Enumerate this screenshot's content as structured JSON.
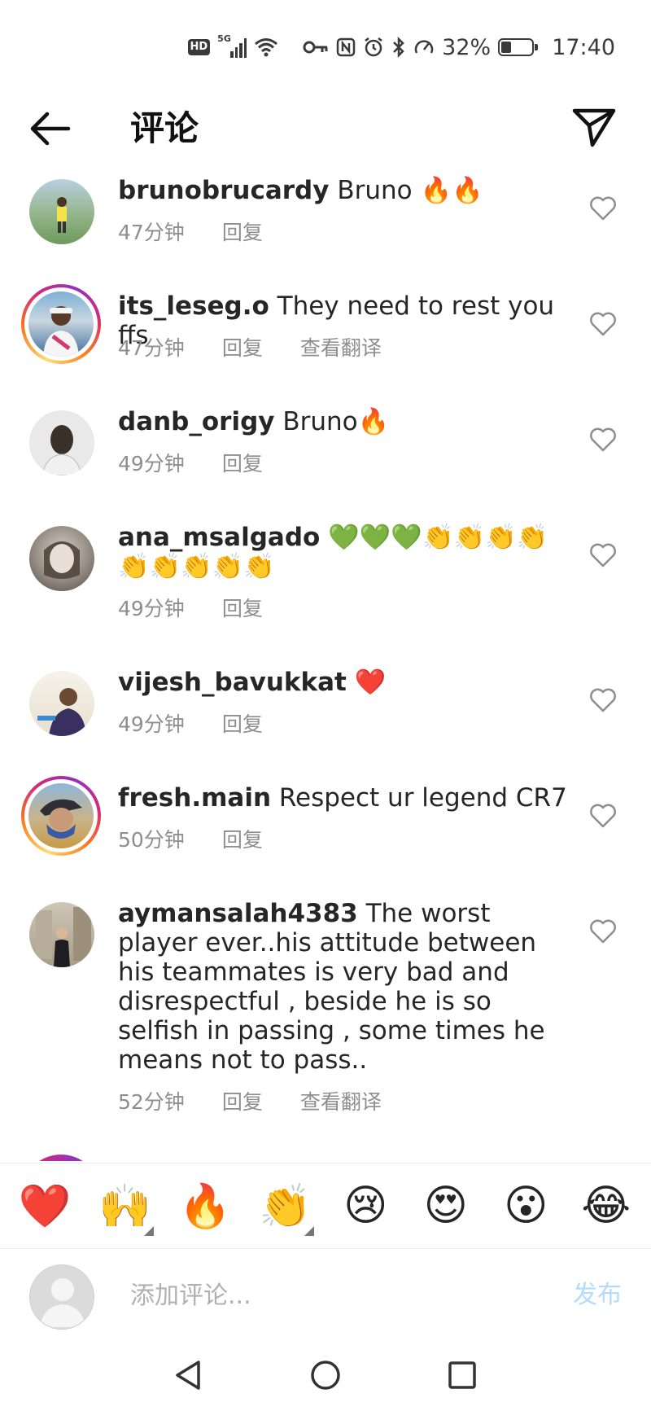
{
  "status_bar": {
    "hd": "HD",
    "network": "5G",
    "battery_percent": "32%",
    "battery_level": 0.32,
    "time": "17:40"
  },
  "header": {
    "title": "评论",
    "back_icon": "arrow-left-icon",
    "share_icon": "send-icon"
  },
  "comments": [
    {
      "username": "brunobrucardy",
      "text": "Bruno 🔥🔥",
      "time": "47分钟",
      "reply": "回复",
      "translate": "",
      "story": false,
      "avatar_color": "#7aa86b"
    },
    {
      "username": "its_leseg.o",
      "text": "They need to rest you ffs",
      "time": "47分钟",
      "reply": "回复",
      "translate": "查看翻译",
      "story": true,
      "avatar_color": "#5a7fa0"
    },
    {
      "username": "danb_origy",
      "text": "Bruno🔥",
      "time": "49分钟",
      "reply": "回复",
      "translate": "",
      "story": false,
      "avatar_color": "#9a9a9a"
    },
    {
      "username": "ana_msalgado",
      "text": "💚💚💚👏👏👏👏👏👏👏👏👏",
      "time": "49分钟",
      "reply": "回复",
      "translate": "",
      "story": false,
      "avatar_color": "#6f6a64"
    },
    {
      "username": "vijesh_bavukkat",
      "text": "❤️",
      "time": "49分钟",
      "reply": "回复",
      "translate": "",
      "story": false,
      "avatar_color": "#4a3a66"
    },
    {
      "username": "fresh.main",
      "text": "Respect ur legend CR7",
      "time": "50分钟",
      "reply": "回复",
      "translate": "",
      "story": true,
      "avatar_color": "#6a8aa0"
    },
    {
      "username": "aymansalah4383",
      "text": "The worst player ever..his attitude between his teammates is very bad and disrespectful , beside he is so selfish in passing , some times he means not to pass..",
      "time": "52分钟",
      "reply": "回复",
      "translate": "查看翻译",
      "story": false,
      "avatar_color": "#5e5a52"
    }
  ],
  "emoji_bar": [
    "❤️",
    "🙌",
    "🔥",
    "👏",
    "😢",
    "😍",
    "😮",
    "😂"
  ],
  "input": {
    "placeholder": "添加评论...",
    "post_label": "发布"
  }
}
